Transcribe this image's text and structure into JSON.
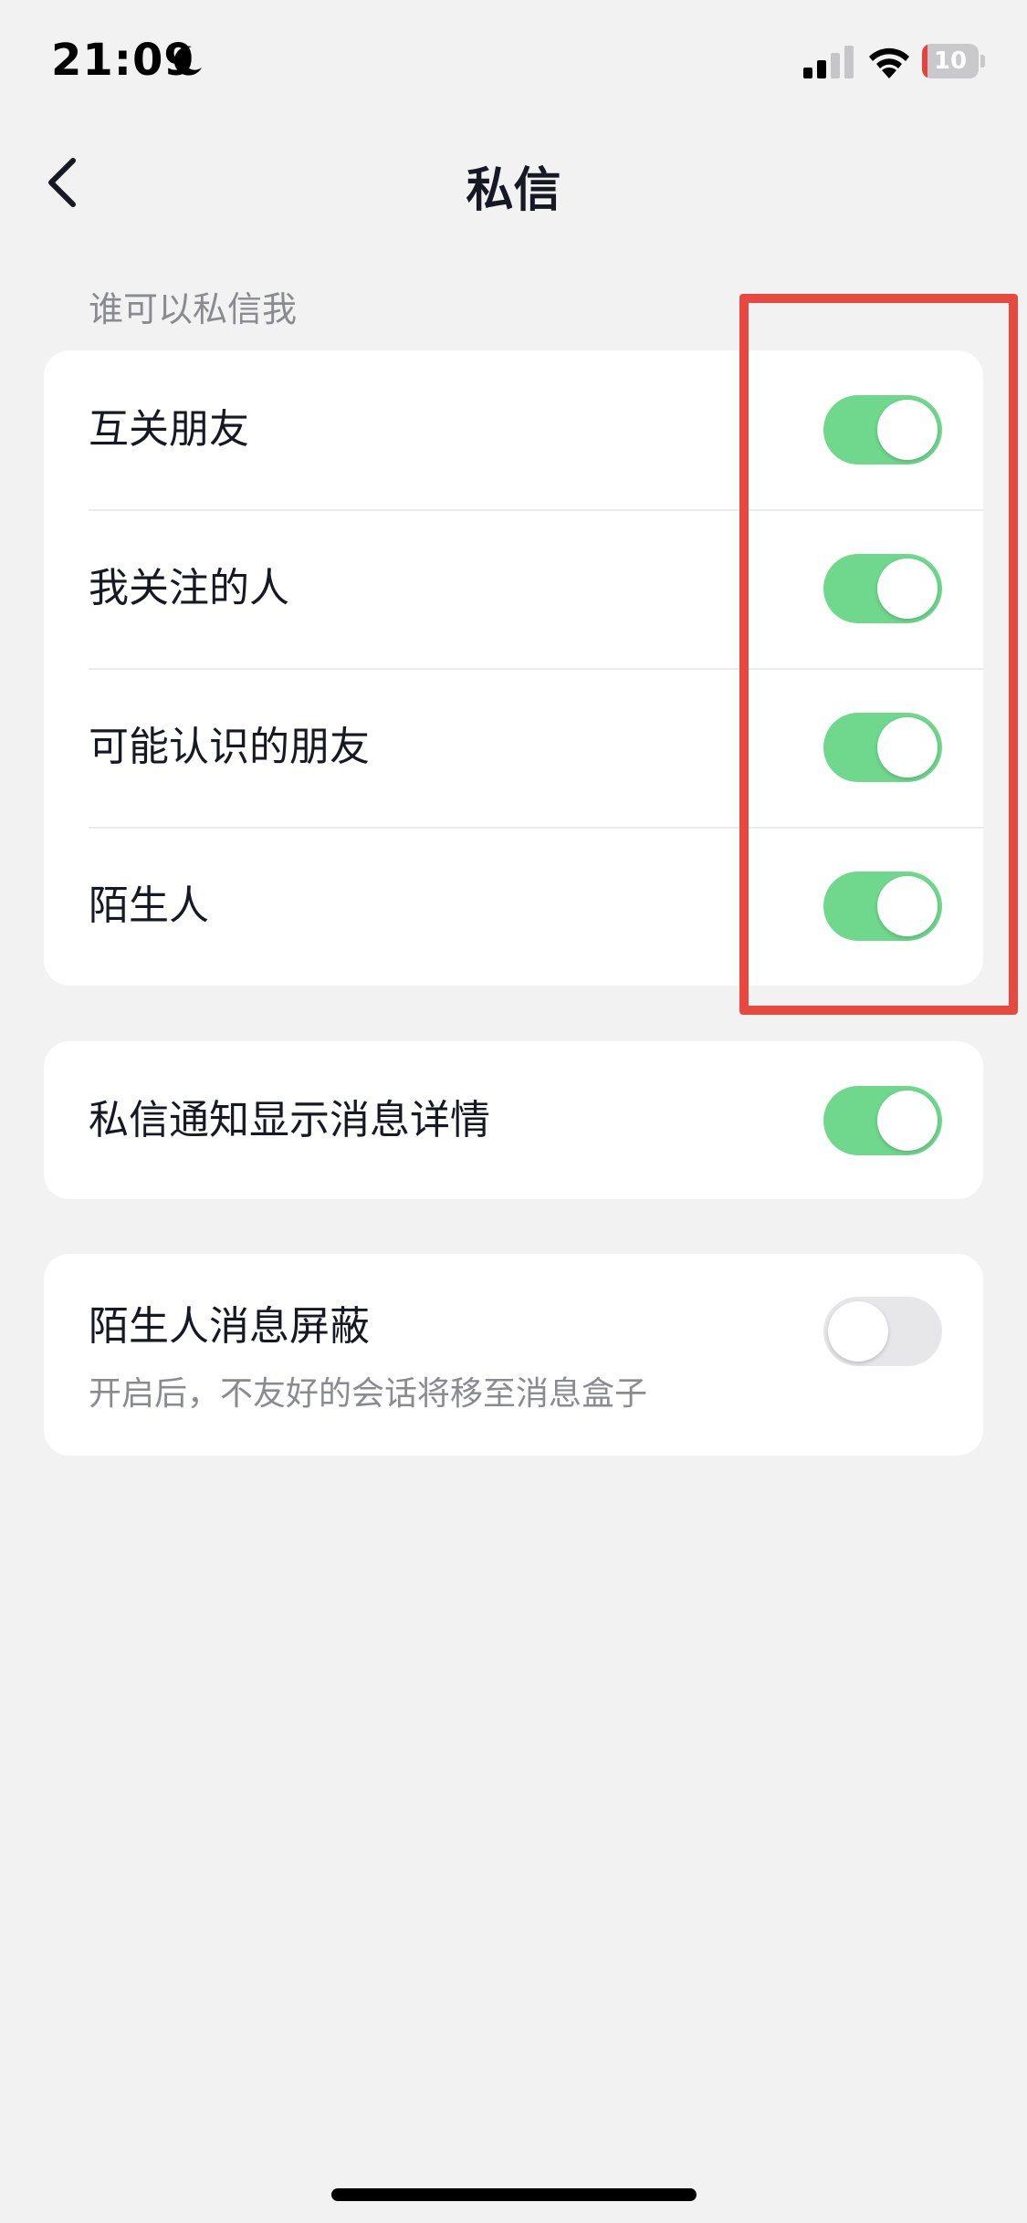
{
  "status_bar": {
    "time": "21:09",
    "battery_level": "10",
    "battery_fraction": 0.1,
    "battery_color": "#e64340",
    "icons": [
      "moon-icon",
      "signal-icon",
      "wifi-icon",
      "battery-charging-icon"
    ]
  },
  "nav": {
    "title": "私信",
    "back_icon": "chevron-left-icon"
  },
  "section": {
    "label": "谁可以私信我"
  },
  "who_can_message": [
    {
      "label": "互关朋友",
      "enabled": true
    },
    {
      "label": "我关注的人",
      "enabled": true
    },
    {
      "label": "可能认识的朋友",
      "enabled": true
    },
    {
      "label": "陌生人",
      "enabled": true
    }
  ],
  "notification_details": {
    "label": "私信通知显示消息详情",
    "enabled": true
  },
  "stranger_block": {
    "label": "陌生人消息屏蔽",
    "description": "开启后，不友好的会话将移至消息盒子",
    "enabled": false
  },
  "colors": {
    "toggle_on": "#6fd88d",
    "toggle_off": "#e7e7ea",
    "highlight": "#e8493f",
    "background": "#f2f2f3"
  }
}
